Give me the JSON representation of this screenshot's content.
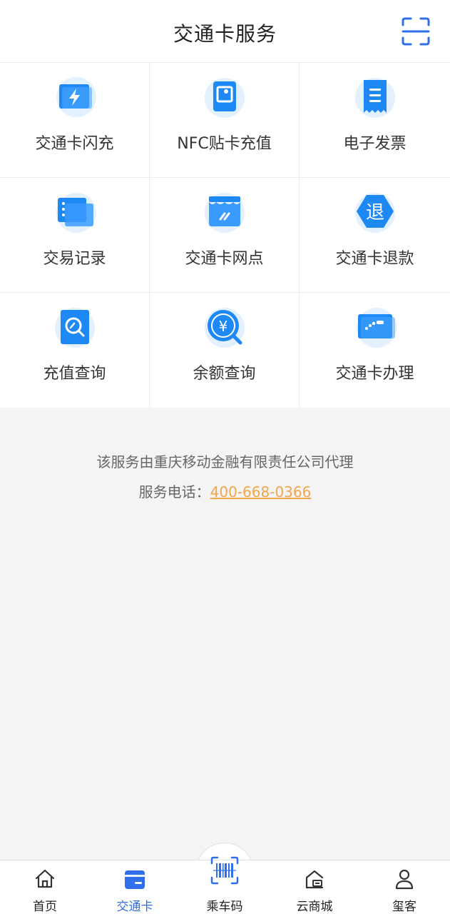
{
  "header": {
    "title": "交通卡服务",
    "scan_icon": "scan-icon"
  },
  "services": [
    {
      "name": "card-quick-topup",
      "label": "交通卡闪充",
      "icon": "lightning-card-icon"
    },
    {
      "name": "nfc-topup",
      "label": "NFC贴卡充值",
      "icon": "nfc-card-icon"
    },
    {
      "name": "e-invoice",
      "label": "电子发票",
      "icon": "invoice-icon"
    },
    {
      "name": "transaction-record",
      "label": "交易记录",
      "icon": "record-list-icon"
    },
    {
      "name": "card-outlet",
      "label": "交通卡网点",
      "icon": "store-icon"
    },
    {
      "name": "card-refund",
      "label": "交通卡退款",
      "icon": "refund-icon"
    },
    {
      "name": "topup-query",
      "label": "充值查询",
      "icon": "search-document-icon"
    },
    {
      "name": "balance-query",
      "label": "余额查询",
      "icon": "yuan-search-icon"
    },
    {
      "name": "card-apply",
      "label": "交通卡办理",
      "icon": "card-apply-icon"
    }
  ],
  "footer": {
    "agent_text": "该服务由重庆移动金融有限责任公司代理",
    "phone_label": "服务电话：",
    "phone_number": "400-668-0366"
  },
  "tabbar": {
    "items": [
      {
        "label": "首页",
        "icon": "home-icon"
      },
      {
        "label": "交通卡",
        "icon": "card-icon",
        "active": true
      },
      {
        "label": "乘车码",
        "icon": "barcode-scan-icon"
      },
      {
        "label": "云商城",
        "icon": "shop-icon"
      },
      {
        "label": "玺客",
        "icon": "user-icon"
      }
    ]
  },
  "colors": {
    "accent": "#2f6fea",
    "phone": "#f2a54a",
    "icon_blue": "#1e88f5"
  }
}
